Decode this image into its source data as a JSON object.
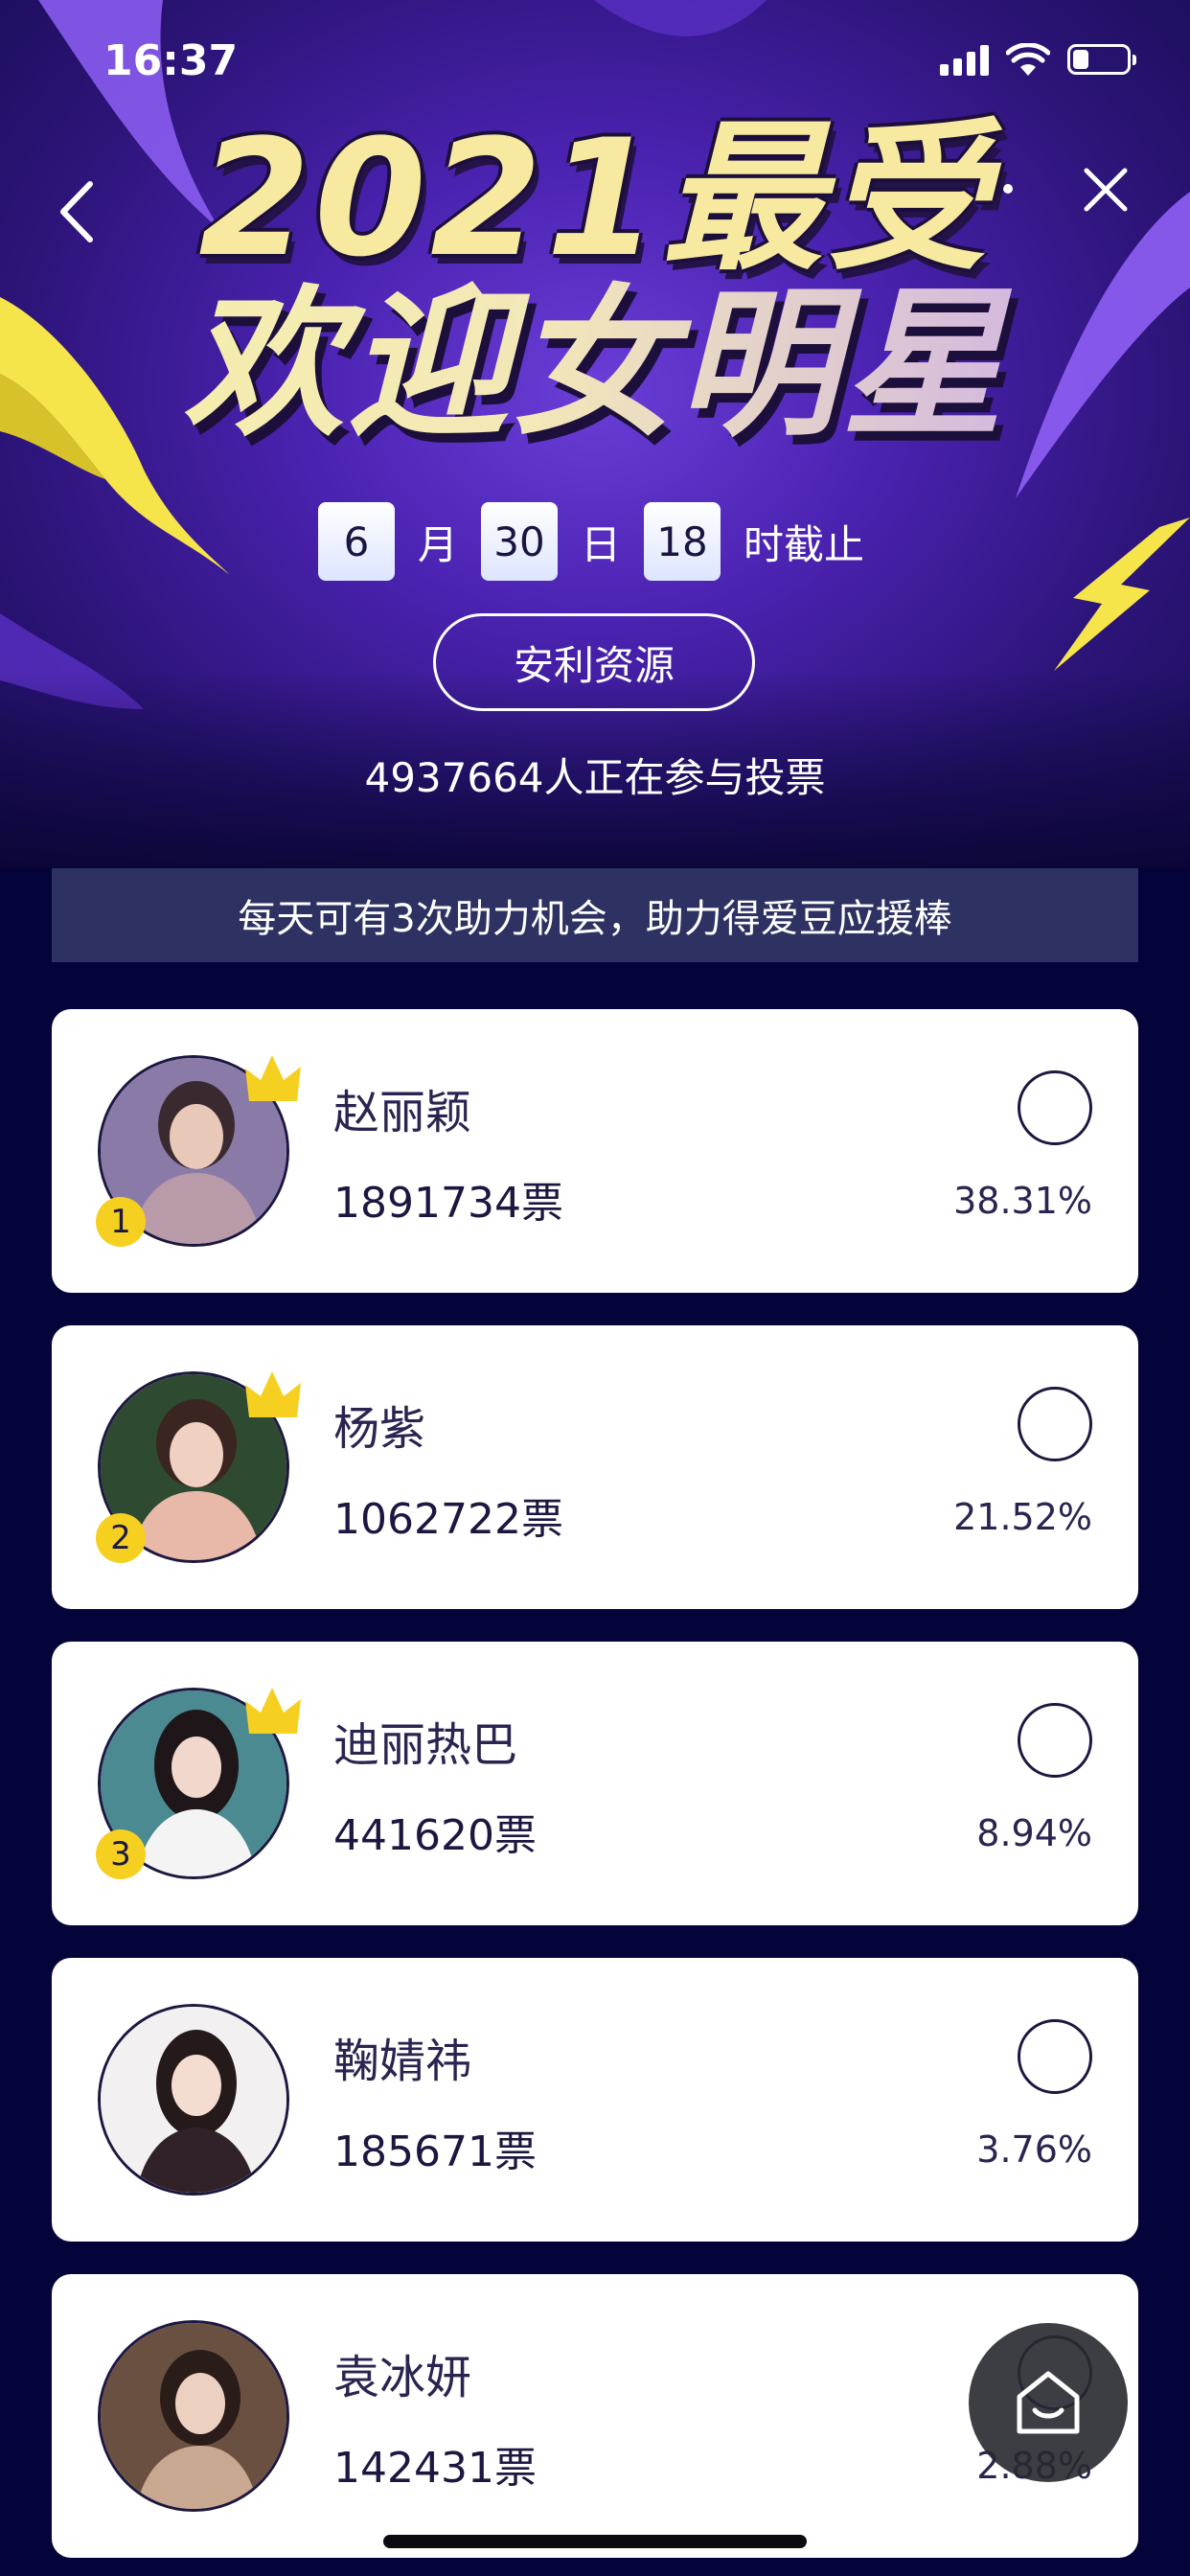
{
  "status_bar": {
    "time": "16:37",
    "icons": [
      "signal-icon",
      "wifi-icon",
      "battery-icon"
    ]
  },
  "nav": {
    "icons": [
      "back-icon",
      "more-icon",
      "close-icon"
    ]
  },
  "hero": {
    "title_line1": "2021最受",
    "title_line2": "欢迎女明星",
    "deadline": {
      "month": "6",
      "month_unit": "月",
      "day": "30",
      "day_unit": "日",
      "hour": "18",
      "hour_suffix": "时截止"
    },
    "resource_button": "安利资源",
    "participants": "4937664人正在参与投票"
  },
  "notice": "每天可有3次助力机会，助力得爱豆应援棒",
  "candidates": [
    {
      "rank": "1",
      "name": "赵丽颖",
      "votes": "1891734票",
      "percent": "38.31%"
    },
    {
      "rank": "2",
      "name": "杨紫",
      "votes": "1062722票",
      "percent": "21.52%"
    },
    {
      "rank": "3",
      "name": "迪丽热巴",
      "votes": "441620票",
      "percent": "8.94%"
    },
    {
      "rank": "",
      "name": "鞠婧祎",
      "votes": "185671票",
      "percent": "3.76%"
    },
    {
      "rank": "",
      "name": "袁冰妍",
      "votes": "142431票",
      "percent": "2.88%"
    }
  ],
  "colors": {
    "hero_purple": "#4a22b0",
    "page_background": "#05043a",
    "notice_bar": "#2e3263",
    "rank_badge": "#f6d020",
    "crown": "#f6d020",
    "title_yellow": "#f7eaa0"
  },
  "floating_button": {
    "icon": "home-icon"
  }
}
